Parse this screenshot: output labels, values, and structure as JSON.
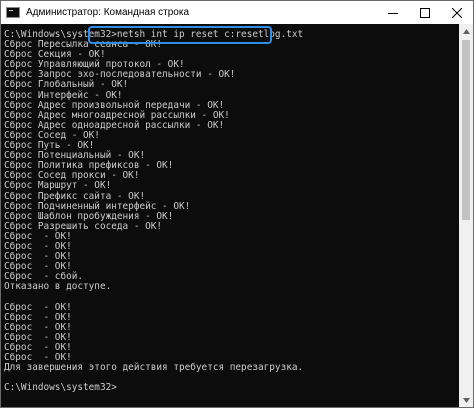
{
  "window": {
    "title": "Администратор: Командная строка",
    "icon": "cmd-icon",
    "controls": [
      "minimize-icon",
      "maximize-icon",
      "close-icon"
    ]
  },
  "console": {
    "lines": [
      "C:\\Windows\\system32>netsh int ip reset c:resetlog.txt",
      "Сброс Пересылка сеанса - OK!",
      "Сброс Секция - OK!",
      "Сброс Управляющий протокол - OK!",
      "Сброс Запрос эхо-последовательности - OK!",
      "Сброс Глобальный - OK!",
      "Сброс Интерфейс - OK!",
      "Сброс Адрес произвольной передачи - OK!",
      "Сброс Адрес многоадресной рассылки - OK!",
      "Сброс Адрес одноадресной рассылки - OK!",
      "Сброс Сосед - OK!",
      "Сброс Путь - OK!",
      "Сброс Потенциальный - OK!",
      "Сброс Политика префиксов - OK!",
      "Сброс Сосед прокси - OK!",
      "Сброс Маршрут - OK!",
      "Сброс Префикс сайта - OK!",
      "Сброс Подчиненный интерфейс - OK!",
      "Сброс Шаблон пробуждения - OK!",
      "Сброс Разрешить соседа - OK!",
      "Сброс  - OK!",
      "Сброс  - OK!",
      "Сброс  - OK!",
      "Сброс  - OK!",
      "Сброс  - сбой.",
      "Отказано в доступе.",
      "",
      "Сброс  - OK!",
      "Сброс  - OK!",
      "Сброс  - OK!",
      "Сброс  - OK!",
      "Сброс  - OK!",
      "Сброс  - OK!",
      "Для завершения этого действия требуется перезагрузка.",
      "",
      "C:\\Windows\\system32>"
    ]
  },
  "colors": {
    "console_bg": "#0c0c0c",
    "console_text": "#cccccc",
    "highlight_border": "#2f8fe8"
  }
}
